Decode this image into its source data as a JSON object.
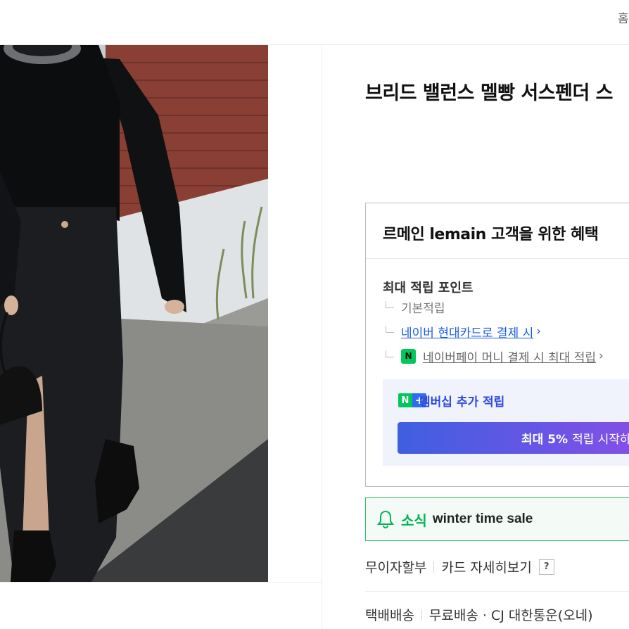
{
  "header": {
    "home_label": "홈"
  },
  "product": {
    "title": "브리드 밸런스 멜빵 서스펜더 스"
  },
  "benefits": {
    "title": "르메인 lemain 고객을 위한 혜택",
    "points_title": "최대 적립 포인트",
    "rows": [
      {
        "label": "기본적립"
      },
      {
        "label": "네이버 현대카드로 결제 시"
      },
      {
        "label": "네이버페이 머니 결제 시 최대 적립"
      }
    ],
    "npay_badge": "N",
    "membership": {
      "badge_n": "N",
      "badge_plus": "+",
      "label": "멤버십 추가 적립",
      "button_bold": "최대 5%",
      "button_rest": "적립 시작하"
    }
  },
  "notice": {
    "tag": "소식",
    "text": "winter time sale"
  },
  "payment": {
    "installment": "무이자할부",
    "card_details": "카드 자세히보기",
    "help": "?"
  },
  "delivery": {
    "type": "택배배송",
    "info": "무료배송 · CJ 대한통운(오네)"
  },
  "colors": {
    "accent_blue": "#1a5de0",
    "naver_green": "#03c75a",
    "notice_border": "#2bc36a",
    "member_purple": "#6a55e6"
  }
}
